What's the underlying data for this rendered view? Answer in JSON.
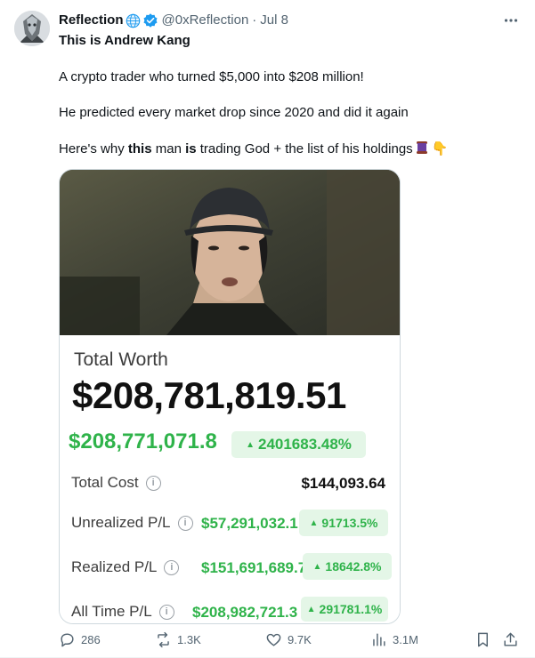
{
  "author": {
    "name": "Reflection",
    "handle": "@0xReflection",
    "separator": "·",
    "date": "Jul 8"
  },
  "tweet": {
    "line1": "This is Andrew Kang",
    "line2": "A crypto trader who turned $5,000 into $208 million!",
    "line3": "He predicted every market drop since 2020 and did it again",
    "line4": {
      "part_a": "Here's why ",
      "bold_a": "this",
      "part_b": " man ",
      "bold_b": "is",
      "part_c": " trading God + the list of his holdings",
      "emoji_pointer": "👇"
    }
  },
  "portfolio": {
    "total_worth_label": "Total Worth",
    "total_worth_value": "$208,781,819.51",
    "green_value": "$208,771,071.8",
    "green_pct": "2401683.48%",
    "total_cost_label": "Total Cost",
    "total_cost_value": "$144,093.64",
    "unrealized_label": "Unrealized P/L",
    "unrealized_value": "$57,291,032.1",
    "unrealized_pct": "91713.5%",
    "realized_label": "Realized P/L",
    "realized_value": "$151,691,689.7",
    "realized_pct": "18642.8%",
    "alltime_label": "All Time P/L",
    "alltime_value": "$208,982,721.3",
    "alltime_pct": "291781.1%",
    "up_triangle": "▲",
    "info_glyph": "i"
  },
  "actions": {
    "replies": "286",
    "reposts": "1.3K",
    "likes": "9.7K",
    "views": "3.1M"
  },
  "colors": {
    "accent_green": "#2fb34a",
    "pill_bg": "#e4f6e7",
    "verified_blue": "#1d9bf0",
    "muted": "#536471"
  },
  "icons": [
    "globe-icon",
    "verified-icon",
    "more-icon",
    "scroll-emoji",
    "reply-icon",
    "repost-icon",
    "like-icon",
    "views-icon",
    "bookmark-icon",
    "share-icon",
    "info-icon"
  ]
}
